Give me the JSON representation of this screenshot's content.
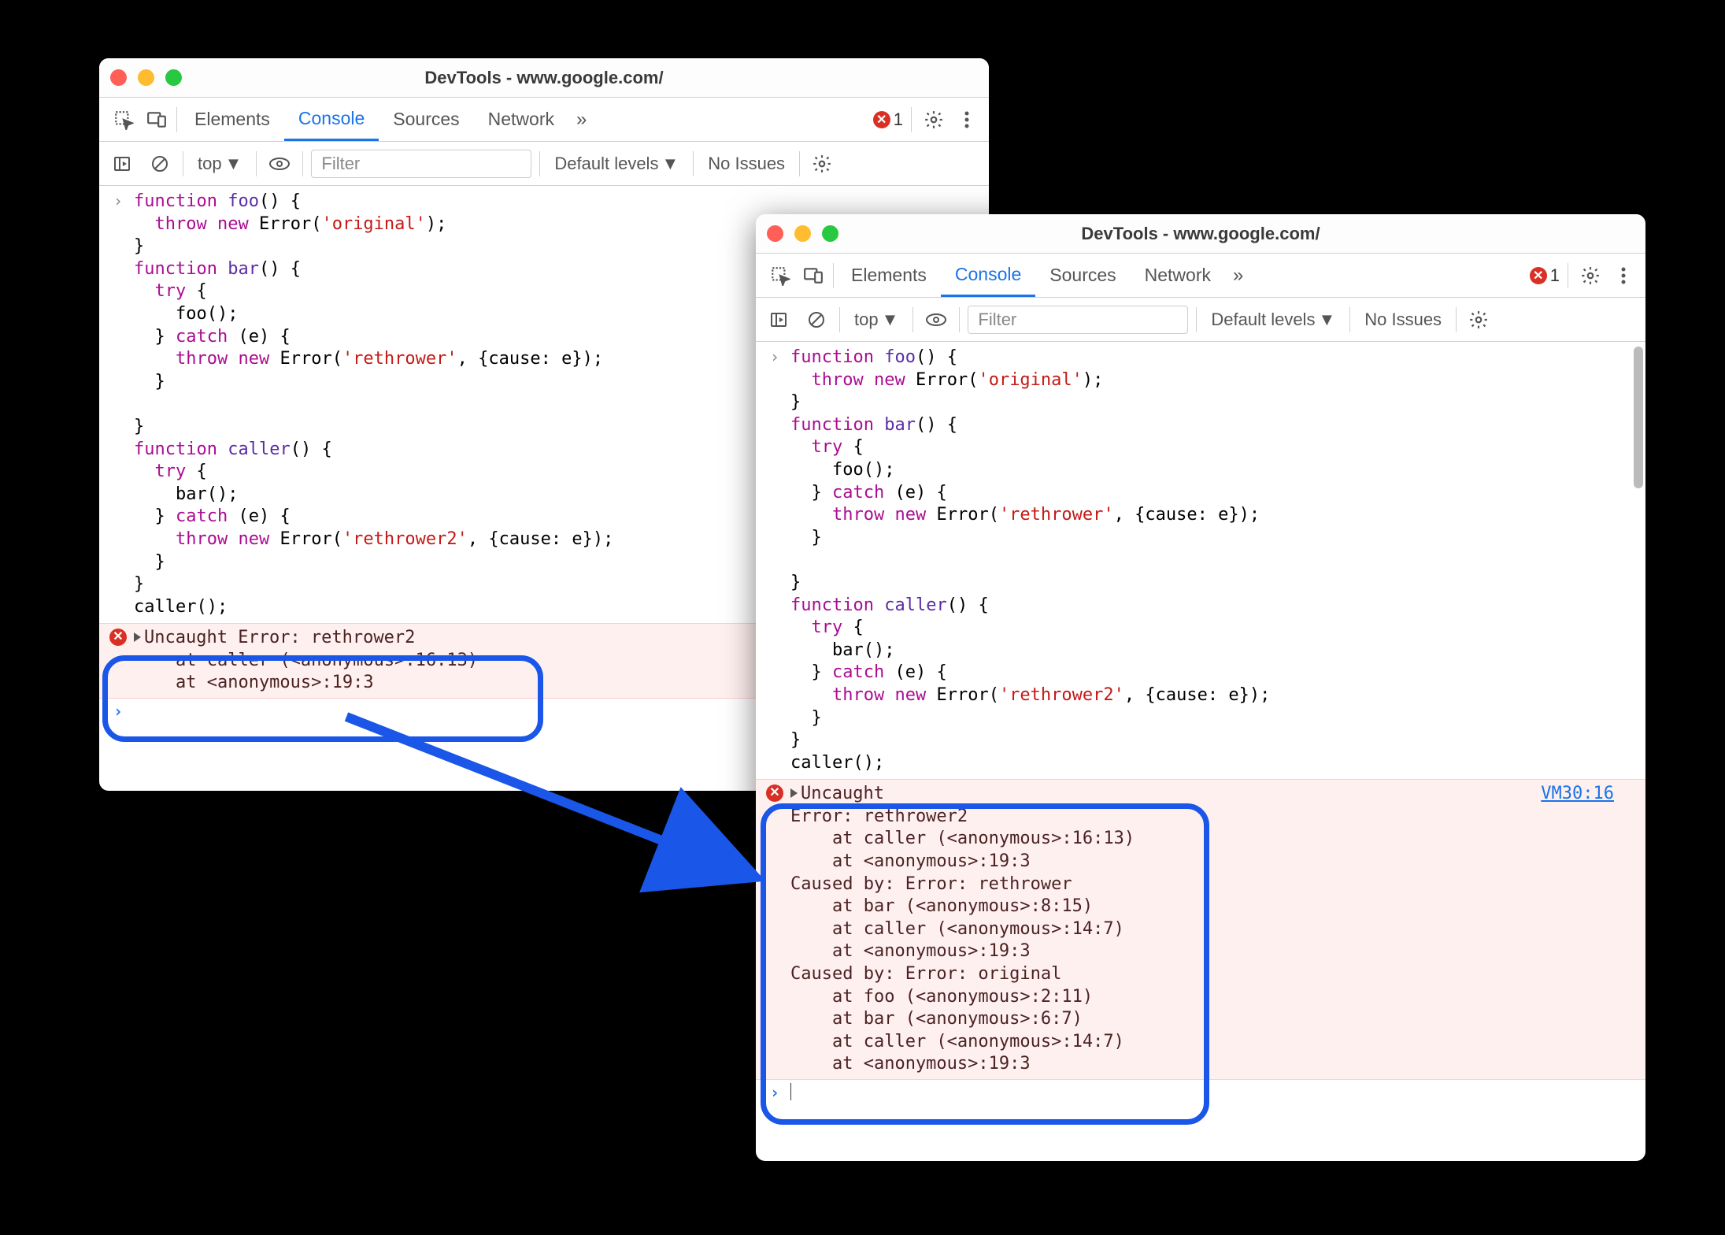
{
  "window_a": {
    "title": "DevTools - www.google.com/",
    "tabs": {
      "t0": "Elements",
      "t1": "Console",
      "t2": "Sources",
      "t3": "Network"
    },
    "error_count": "1",
    "context": "top",
    "filter_placeholder": "Filter",
    "levels_label": "Default levels",
    "issues_label": "No Issues",
    "error_text": "Uncaught Error: rethrower2\n    at caller (<anonymous>:16:13)\n    at <anonymous>:19:3"
  },
  "window_b": {
    "title": "DevTools - www.google.com/",
    "tabs": {
      "t0": "Elements",
      "t1": "Console",
      "t2": "Sources",
      "t3": "Network"
    },
    "error_count": "1",
    "context": "top",
    "filter_placeholder": "Filter",
    "levels_label": "Default levels",
    "issues_label": "No Issues",
    "vm_link": "VM30:16",
    "error_text": "Uncaught \nError: rethrower2\n    at caller (<anonymous>:16:13)\n    at <anonymous>:19:3\nCaused by: Error: rethrower\n    at bar (<anonymous>:8:15)\n    at caller (<anonymous>:14:7)\n    at <anonymous>:19:3\nCaused by: Error: original\n    at foo (<anonymous>:2:11)\n    at bar (<anonymous>:6:7)\n    at caller (<anonymous>:14:7)\n    at <anonymous>:19:3"
  },
  "code": {
    "line1": "function foo() {",
    "line2": "  throw new Error('original');",
    "line3": "}",
    "line4": "function bar() {",
    "line5": "  try {",
    "line6": "    foo();",
    "line7": "  } catch (e) {",
    "line8": "    throw new Error('rethrower', {cause: e});",
    "line9": "  }",
    "line10_blank": "",
    "line10": "}",
    "line11": "function caller() {",
    "line12": "  try {",
    "line13": "    bar();",
    "line14": "  } catch (e) {",
    "line15": "    throw new Error('rethrower2', {cause: e});",
    "line16": "  }",
    "line17": "}",
    "line18": "caller();"
  }
}
